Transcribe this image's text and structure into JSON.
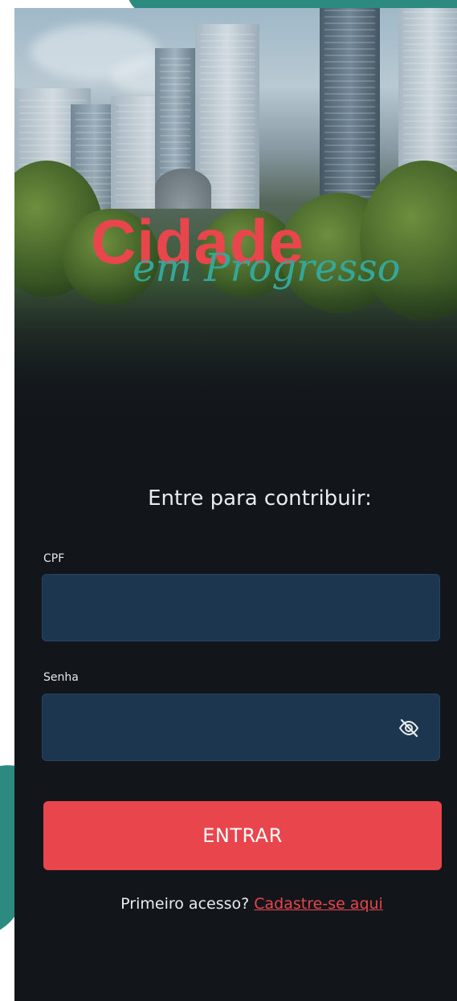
{
  "logo": {
    "main": "Cidade",
    "sub": "em Progresso"
  },
  "form": {
    "title": "Entre para contribuir:",
    "cpf_label": "CPF",
    "cpf_value": "",
    "password_label": "Senha",
    "password_value": "",
    "password_toggle_icon": "eye-off-icon",
    "submit_label": "ENTRAR",
    "first_access_text": "Primeiro acesso?",
    "signup_link": "Cadastre-se aqui"
  },
  "colors": {
    "accent": "#e8454c",
    "teal": "#35a79a",
    "background": "#12161b",
    "input_bg": "#1d3650"
  }
}
